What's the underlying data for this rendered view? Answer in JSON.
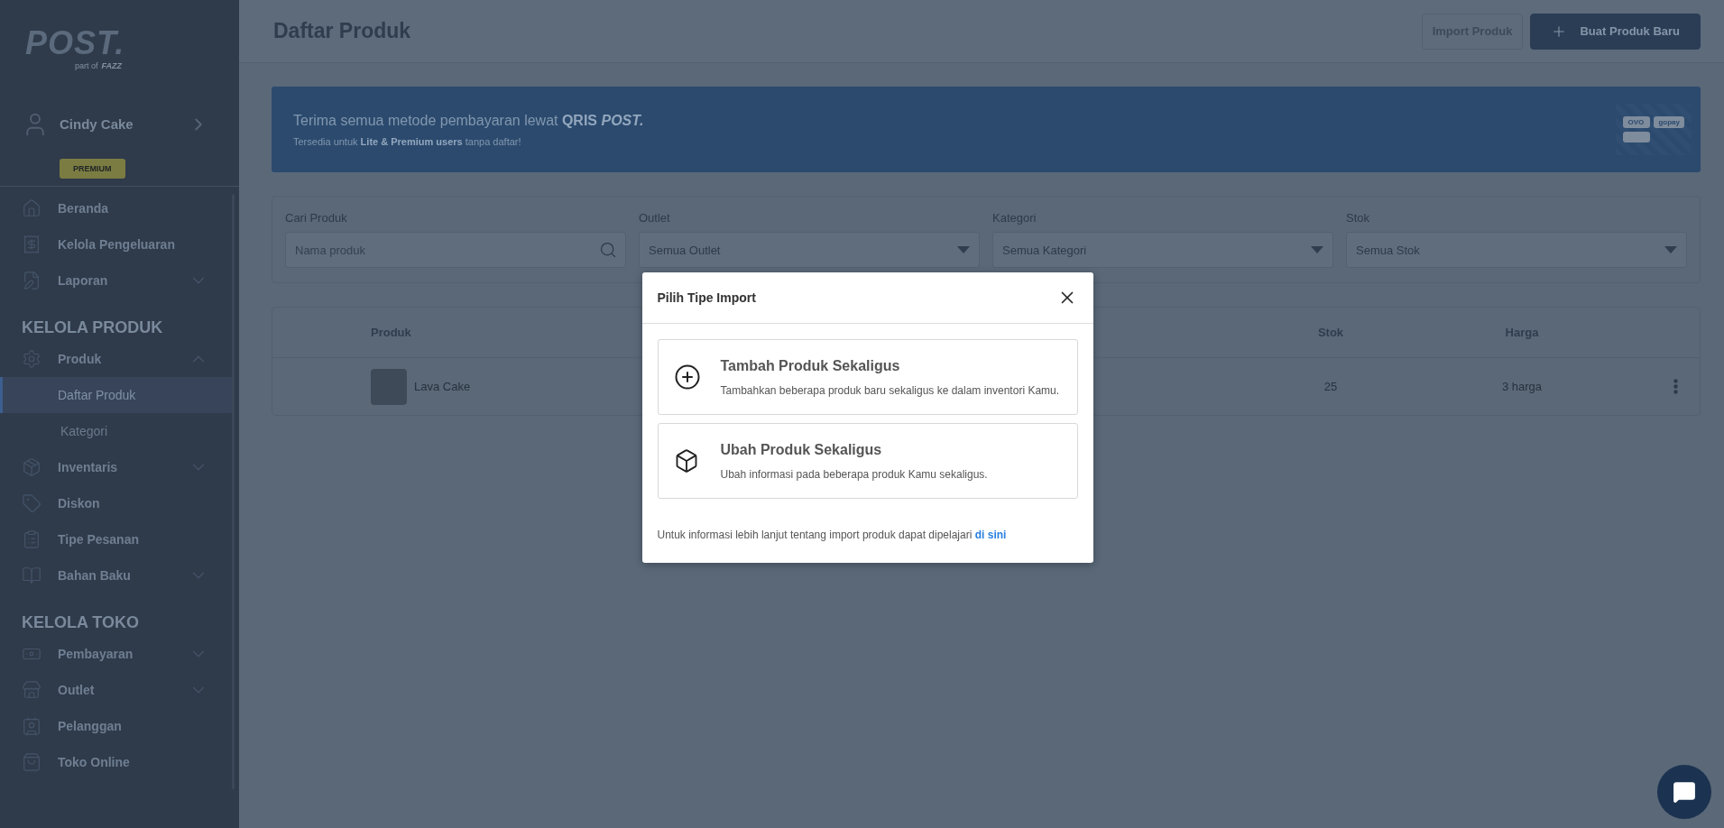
{
  "logo": {
    "wordmark": "POST.",
    "tagline": "part of",
    "partner": "FAZZ"
  },
  "user": {
    "name": "Cindy Cake",
    "badge": "PREMIUM"
  },
  "nav": [
    {
      "items": [
        {
          "label": "Beranda",
          "kind": "link"
        },
        {
          "label": "Kelola Pengeluaran",
          "kind": "link"
        },
        {
          "label": "Laporan",
          "kind": "group",
          "expanded": false
        }
      ]
    },
    {
      "heading": "KELOLA PRODUK",
      "items": [
        {
          "label": "Produk",
          "kind": "group",
          "expanded": true,
          "children": [
            {
              "label": "Daftar Produk",
              "selected": true
            },
            {
              "label": "Kategori",
              "selected": false
            }
          ]
        },
        {
          "label": "Inventaris",
          "kind": "group",
          "expanded": false
        },
        {
          "label": "Diskon",
          "kind": "link"
        },
        {
          "label": "Tipe Pesanan",
          "kind": "link"
        },
        {
          "label": "Bahan Baku",
          "kind": "group",
          "expanded": false
        }
      ]
    },
    {
      "heading": "KELOLA TOKO",
      "items": [
        {
          "label": "Pembayaran",
          "kind": "group",
          "expanded": false
        },
        {
          "label": "Outlet",
          "kind": "group",
          "expanded": false
        },
        {
          "label": "Pelanggan",
          "kind": "link"
        },
        {
          "label": "Toko Online",
          "kind": "link"
        }
      ]
    }
  ],
  "header": {
    "title": "Daftar Produk",
    "buttons": [
      {
        "label": "Import Produk",
        "kind": "secondary"
      },
      {
        "label": "Buat Produk Baru",
        "kind": "primary"
      }
    ]
  },
  "banner": {
    "headline": "Terima semua metode pembayaran lewat **QRIS** *POST.*",
    "subline": "Tersedia untuk **Lite & Premium users** tanpa daftar!",
    "logos": [
      "OVO",
      "gopay"
    ]
  },
  "filters": [
    {
      "label": "Cari Produk",
      "kind": "search",
      "placeholder": "Nama produk"
    },
    {
      "label": "Outlet",
      "kind": "select",
      "value": "Semua Outlet"
    },
    {
      "label": "Kategori",
      "kind": "select",
      "value": "Semua Kategori"
    },
    {
      "label": "Stok",
      "kind": "select",
      "value": "Semua Stok"
    }
  ],
  "table": {
    "columns": [
      "Produk",
      "Stok",
      "Harga"
    ],
    "rows": [
      {
        "product": "Lava Cake",
        "stock": "25",
        "price": "3 harga"
      }
    ]
  },
  "modal": {
    "title": "Pilih Tipe Import",
    "options": [
      {
        "title": "Tambah Produk Sekaligus",
        "description": "Tambahkan beberapa produk baru sekaligus ke dalam inventori Kamu."
      },
      {
        "title": "Ubah Produk Sekaligus",
        "description": "Ubah informasi pada beberapa produk Kamu sekaligus."
      }
    ],
    "footer": {
      "text": "Untuk informasi lebih lanjut tentang import produk dapat dipelajari",
      "link": "di sini"
    }
  }
}
